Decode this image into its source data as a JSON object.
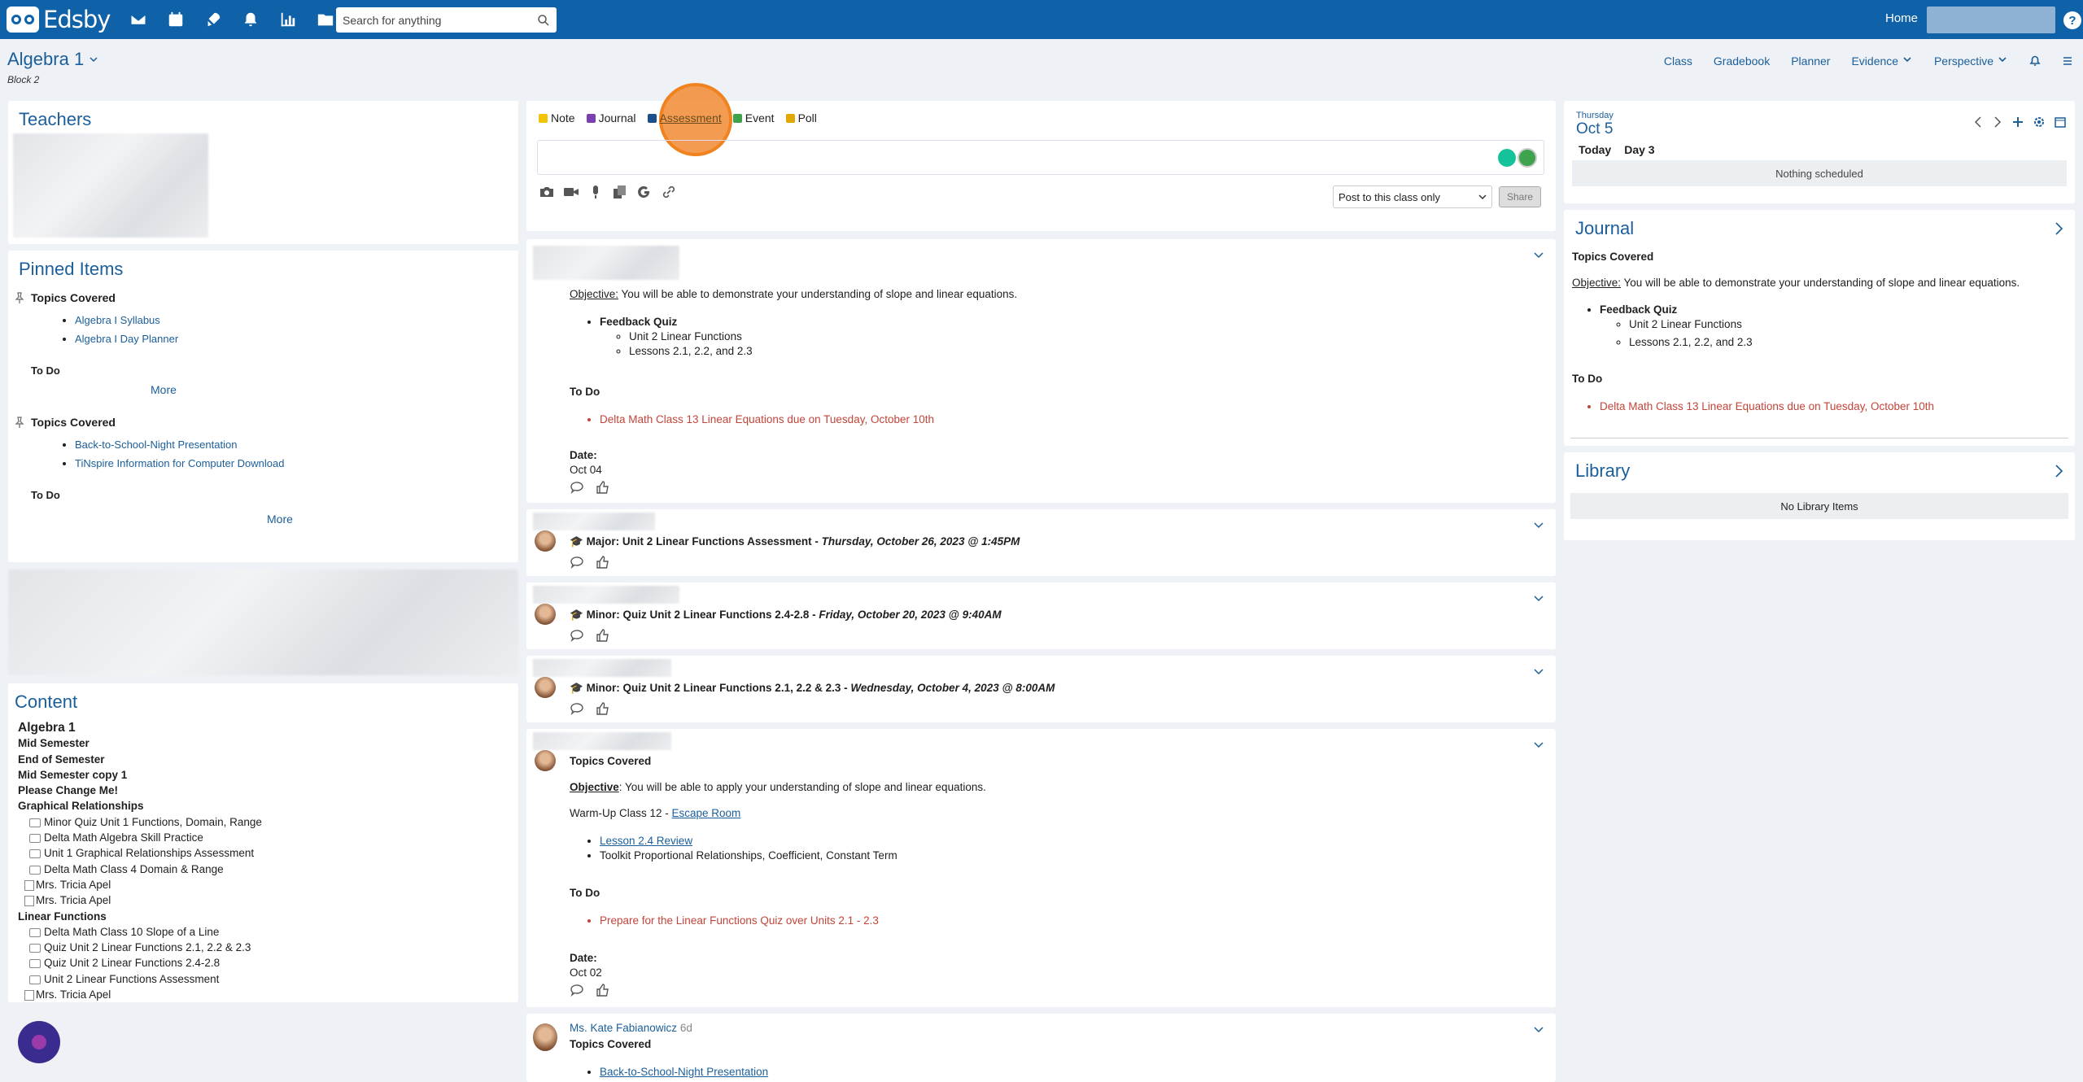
{
  "app": {
    "name": "Edsby",
    "search_placeholder": "Search for anything",
    "home_label": "Home",
    "help_label": "?"
  },
  "class": {
    "title": "Algebra 1",
    "subtitle": "Block 2",
    "nav": [
      "Class",
      "Gradebook",
      "Planner",
      "Evidence",
      "Perspective"
    ]
  },
  "teachers": {
    "title": "Teachers"
  },
  "pinned": {
    "title": "Pinned Items",
    "groups": [
      {
        "heading": "Topics Covered",
        "links": [
          "Algebra I Syllabus",
          "Algebra I Day Planner"
        ],
        "todo": "To Do",
        "more": "More"
      },
      {
        "heading": "Topics Covered",
        "links": [
          "Back-to-School-Night Presentation",
          "TiNspire Information for Computer Download"
        ],
        "todo": "To Do",
        "more": "More"
      }
    ]
  },
  "content": {
    "title": "Content",
    "items": [
      {
        "t": "Algebra 1",
        "k": "top"
      },
      {
        "t": "Mid Semester",
        "k": "head"
      },
      {
        "t": "End of Semester",
        "k": "head"
      },
      {
        "t": "Mid Semester copy 1",
        "k": "head"
      },
      {
        "t": "Please Change Me!",
        "k": "head"
      },
      {
        "t": "Graphical Relationships",
        "k": "head"
      },
      {
        "t": "Minor Quiz Unit 1 Functions, Domain, Range",
        "k": "item"
      },
      {
        "t": "Delta Math Algebra Skill Practice",
        "k": "item"
      },
      {
        "t": "Unit 1 Graphical Relationships Assessment",
        "k": "item"
      },
      {
        "t": "Delta Math Class 4 Domain & Range",
        "k": "item"
      },
      {
        "t": "Mrs. Tricia Apel",
        "k": "note"
      },
      {
        "t": "Mrs. Tricia Apel",
        "k": "note"
      },
      {
        "t": "Linear Functions",
        "k": "head"
      },
      {
        "t": "Delta Math Class 10 Slope of a Line",
        "k": "item"
      },
      {
        "t": "Quiz Unit 2 Linear Functions 2.1, 2.2 & 2.3",
        "k": "item"
      },
      {
        "t": "Quiz Unit 2 Linear Functions 2.4-2.8",
        "k": "item"
      },
      {
        "t": "Unit 2 Linear Functions Assessment",
        "k": "item"
      },
      {
        "t": "Mrs. Tricia Apel",
        "k": "note"
      }
    ]
  },
  "composer": {
    "tabs": [
      {
        "label": "Note",
        "color": "#f2c300"
      },
      {
        "label": "Journal",
        "color": "#7a3fb0"
      },
      {
        "label": "Assessment",
        "color": "#1b4e8a"
      },
      {
        "label": "Event",
        "color": "#3fa34d"
      },
      {
        "label": "Poll",
        "color": "#e0a800"
      }
    ],
    "post_option": "Post to this class only",
    "share": "Share"
  },
  "posts": {
    "p1": {
      "objective_label": "Objective:",
      "objective": " You will be able to demonstrate your understanding of slope and linear equations.",
      "quiz": "Feedback Quiz",
      "sub": [
        "Unit 2 Linear Functions",
        "Lessons 2.1, 2.2, and 2.3"
      ],
      "todo": "To Do",
      "todo_item": "Delta Math Class 13 Linear Equations due on Tuesday, October 10th",
      "date_label": "Date:",
      "date": "Oct 04"
    },
    "a1": {
      "prefix": "Major: Unit 2 Linear Functions Assessment - ",
      "when": "Thursday, October 26, 2023 @ 1:45PM"
    },
    "a2": {
      "prefix": "Minor: Quiz Unit 2 Linear Functions 2.4-2.8  - ",
      "when": "Friday, October 20, 2023 @ 9:40AM"
    },
    "a3": {
      "prefix": "Minor: Quiz Unit 2 Linear Functions 2.1, 2.2 & 2.3 - ",
      "when": "Wednesday, October 4, 2023 @ 8:00AM"
    },
    "p2": {
      "heading": "Topics Covered",
      "objective_label": "Objective",
      "objective": ": You will be able to apply your understanding of slope and linear equations.",
      "warmup": "Warm-Up Class 12 - ",
      "warmup_link": " Escape Room",
      "link": "Lesson 2.4 Review",
      "toolkit": "Toolkit Proportional Relationships, Coefficient, Constant Term",
      "todo": "To Do",
      "todo_item": "Prepare for the Linear Functions Quiz over Units 2.1 - 2.3",
      "date_label": "Date:",
      "date": "Oct 02"
    },
    "p3": {
      "author": "Ms. Kate Fabianowicz",
      "age": "6d",
      "heading": "Topics Covered",
      "link": "Back-to-School-Night Presentation"
    }
  },
  "calendar": {
    "weekday": "Thursday",
    "date": "Oct 5",
    "today": "Today",
    "day": "Day 3",
    "empty": "Nothing scheduled"
  },
  "journal": {
    "title": "Journal",
    "heading": "Topics Covered",
    "objective_label": "Objective:",
    "objective": " You will be able to demonstrate your understanding of slope and linear equations.",
    "quiz": "Feedback Quiz",
    "sub": [
      "Unit 2 Linear Functions",
      "Lessons 2.1, 2.2, and 2.3"
    ],
    "todo": "To Do",
    "todo_item": "Delta Math Class 13 Linear Equations due on Tuesday, October 10th"
  },
  "library": {
    "title": "Library",
    "empty": "No Library Items"
  }
}
